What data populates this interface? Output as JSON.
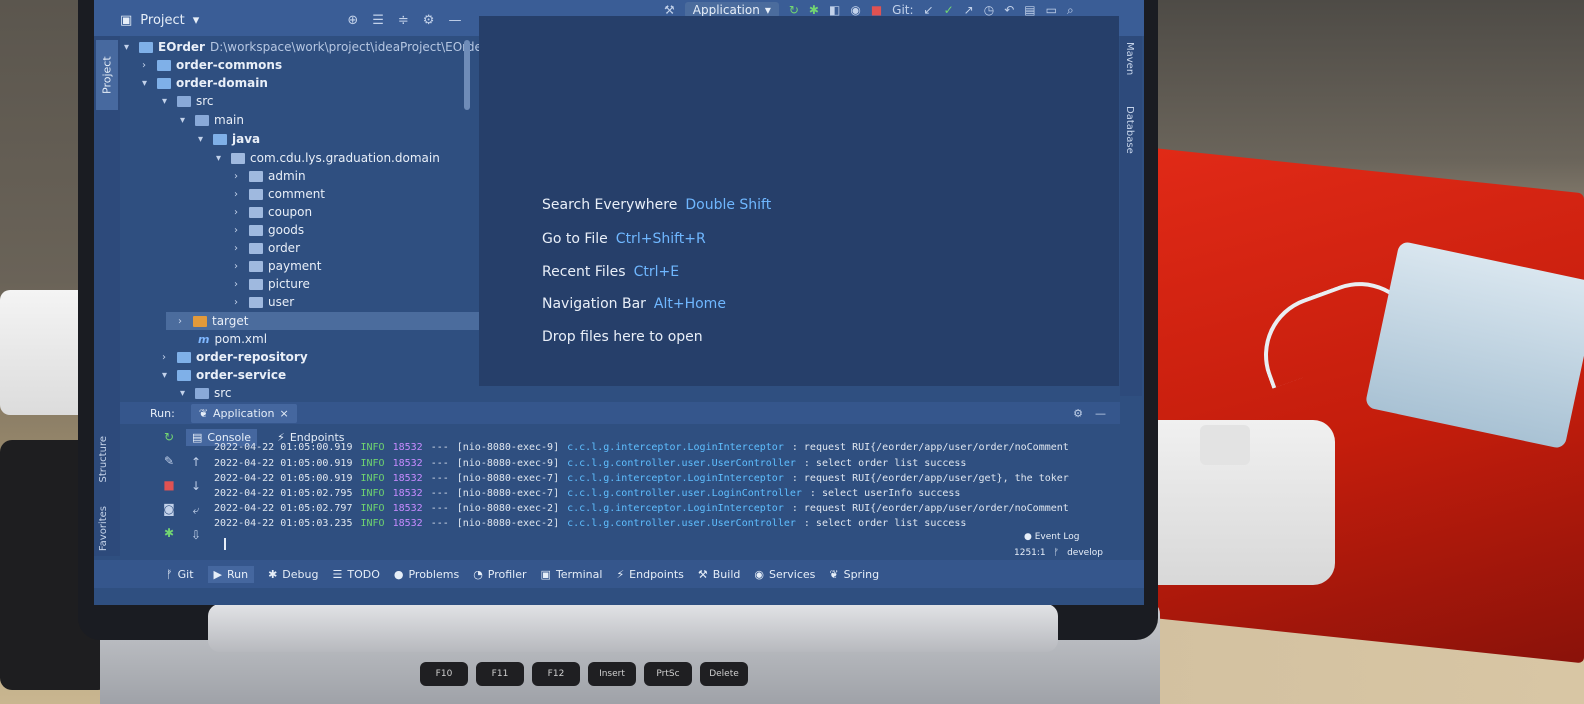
{
  "toolbar": {
    "run_config": "Application",
    "git_label": "Git:"
  },
  "left_stripe": {
    "project_tab": "Project",
    "structure": "Structure",
    "favorites": "Favorites"
  },
  "right_stripe": {
    "maven": "Maven",
    "database": "Database"
  },
  "project_panel": {
    "title": "Project",
    "tree": [
      {
        "label": "EOrder",
        "path": "D:\\workspace\\work\\project\\ideaProject\\EOrder"
      },
      {
        "label": "order-commons"
      },
      {
        "label": "order-domain"
      },
      {
        "label": "src"
      },
      {
        "label": "main"
      },
      {
        "label": "java"
      },
      {
        "label": "com.cdu.lys.graduation.domain"
      },
      {
        "label": "admin"
      },
      {
        "label": "comment"
      },
      {
        "label": "coupon"
      },
      {
        "label": "goods"
      },
      {
        "label": "order"
      },
      {
        "label": "payment"
      },
      {
        "label": "picture"
      },
      {
        "label": "user"
      },
      {
        "label": "target"
      },
      {
        "label": "pom.xml"
      },
      {
        "label": "order-repository"
      },
      {
        "label": "order-service"
      },
      {
        "label": "src"
      }
    ]
  },
  "editor": {
    "hints": [
      {
        "label": "Search Everywhere",
        "key": "Double Shift"
      },
      {
        "label": "Go to File",
        "key": "Ctrl+Shift+R"
      },
      {
        "label": "Recent Files",
        "key": "Ctrl+E"
      },
      {
        "label": "Navigation Bar",
        "key": "Alt+Home"
      },
      {
        "label": "Drop files here to open",
        "key": ""
      }
    ]
  },
  "run_panel": {
    "run_label": "Run:",
    "tab": "Application",
    "console_tab": "Console",
    "endpoints_tab": "Endpoints",
    "logs": [
      {
        "time": "2022-04-22 01:05:00.919",
        "level": "INFO",
        "pid": "18532",
        "sep": "---",
        "thread": "[nio-8080-exec-9]",
        "logger": "c.c.l.g.interceptor.LoginInterceptor",
        "msg": ": request RUI{/eorder/app/user/order/noComment"
      },
      {
        "time": "2022-04-22 01:05:00.919",
        "level": "INFO",
        "pid": "18532",
        "sep": "---",
        "thread": "[nio-8080-exec-9]",
        "logger": "c.c.l.g.controller.user.UserController",
        "msg": ": select order list success"
      },
      {
        "time": "2022-04-22 01:05:00.919",
        "level": "INFO",
        "pid": "18532",
        "sep": "---",
        "thread": "[nio-8080-exec-7]",
        "logger": "c.c.l.g.interceptor.LoginInterceptor",
        "msg": ": request RUI{/eorder/app/user/get}, the toker"
      },
      {
        "time": "2022-04-22 01:05:02.795",
        "level": "INFO",
        "pid": "18532",
        "sep": "---",
        "thread": "[nio-8080-exec-7]",
        "logger": "c.c.l.g.controller.user.LoginController",
        "msg": ": select userInfo success"
      },
      {
        "time": "2022-04-22 01:05:02.797",
        "level": "INFO",
        "pid": "18532",
        "sep": "---",
        "thread": "[nio-8080-exec-2]",
        "logger": "c.c.l.g.interceptor.LoginInterceptor",
        "msg": ": request RUI{/eorder/app/user/order/noComment"
      },
      {
        "time": "2022-04-22 01:05:03.235",
        "level": "INFO",
        "pid": "18532",
        "sep": "---",
        "thread": "[nio-8080-exec-2]",
        "logger": "c.c.l.g.controller.user.UserController",
        "msg": ": select order list success"
      }
    ]
  },
  "status": {
    "event_log": "Event Log",
    "position": "1251:1",
    "branch": "develop"
  },
  "bottom_tabs": [
    "Git",
    "Run",
    "Debug",
    "TODO",
    "Problems",
    "Profiler",
    "Terminal",
    "Endpoints",
    "Build",
    "Services",
    "Spring"
  ],
  "keyboard": [
    "F10",
    "F11",
    "F12",
    "Insert",
    "PrtSc",
    "Delete"
  ]
}
